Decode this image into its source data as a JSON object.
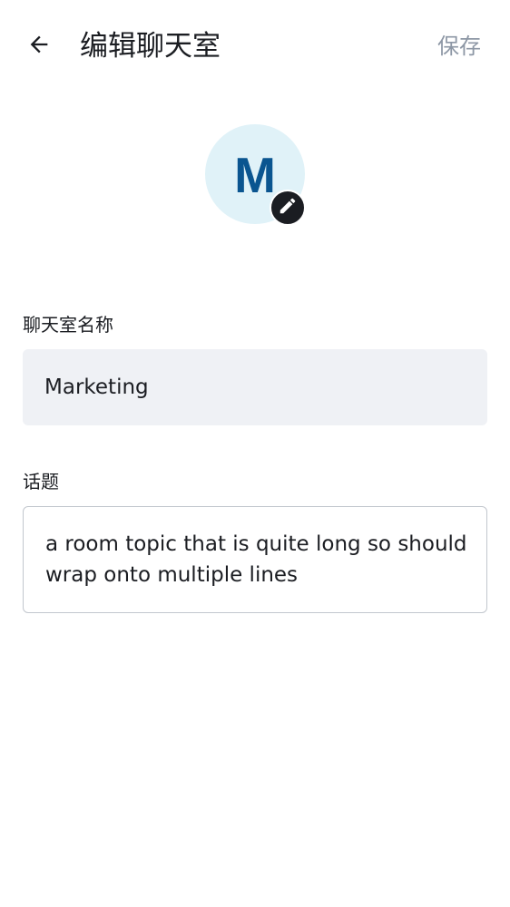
{
  "header": {
    "title": "编辑聊天室",
    "save_label": "保存",
    "back_icon": "arrow-left-icon"
  },
  "avatar": {
    "initial": "M",
    "background_color": "#e0f2f8",
    "letter_color": "#0a5590",
    "edit_icon": "pencil-icon"
  },
  "form": {
    "name_label": "聊天室名称",
    "name_value": "Marketing",
    "topic_label": "话题",
    "topic_value": "a room topic that is quite long so should wrap onto multiple lines"
  },
  "colors": {
    "save_disabled": "#8d97a5",
    "field_background": "#eff1f5",
    "badge": "#1b1d22"
  }
}
